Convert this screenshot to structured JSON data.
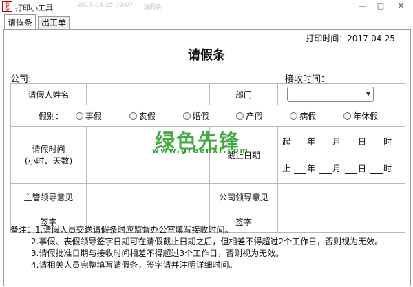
{
  "window": {
    "title": "打印小工具",
    "icon_text": "假条",
    "ghost_text_1": "2017-04-25 09:07",
    "ghost_text_2": "请假条",
    "controls": {
      "minimize": "—",
      "maximize": "□",
      "close": "✕"
    }
  },
  "tabs": [
    {
      "label": "请假条",
      "active": true
    },
    {
      "label": "出工单",
      "active": false
    }
  ],
  "header": {
    "print_time": "打印时间：2017-04-25",
    "title": "请假条",
    "company_label": "公司:",
    "receive_time_label": "接收时间："
  },
  "form": {
    "name_label": "请假人姓名",
    "department_label": "部门",
    "department_value": "",
    "leave_type_label": "假别：",
    "leave_types": [
      "事假",
      "丧假",
      "婚假",
      "产假",
      "病假",
      "年休假"
    ],
    "leave_time_label_1": "请假时间",
    "leave_time_label_2": "(小时、天数)",
    "end_date_label": "截止日期",
    "start_label": "起",
    "end_label": "止",
    "year": "年",
    "month": "月",
    "day": "日",
    "hour": "时",
    "supervisor_label": "主管领导意见",
    "company_leader_label": "公司领导意见",
    "sign_label": "签字",
    "sign_label_2": "签字"
  },
  "notes": [
    "备注：1.请假人员交送请假条时应监督办公室填写接收时间。",
    "2.事假、丧假领导签字日期可在请假截止日期之后，但相差不得超过2个工作日，否则视为无效。",
    "3.请假批准日期与接收时间相差不得超过3个工作日，否则视为无效。",
    "4.请相关人员完整填写请假条，签字请并注明详细时间。"
  ],
  "watermark": {
    "main": "绿色先锋",
    "sub": "www.greenxf.com"
  },
  "colors": {
    "watermark": "#2fa32f",
    "border": "#b8b8b8"
  }
}
